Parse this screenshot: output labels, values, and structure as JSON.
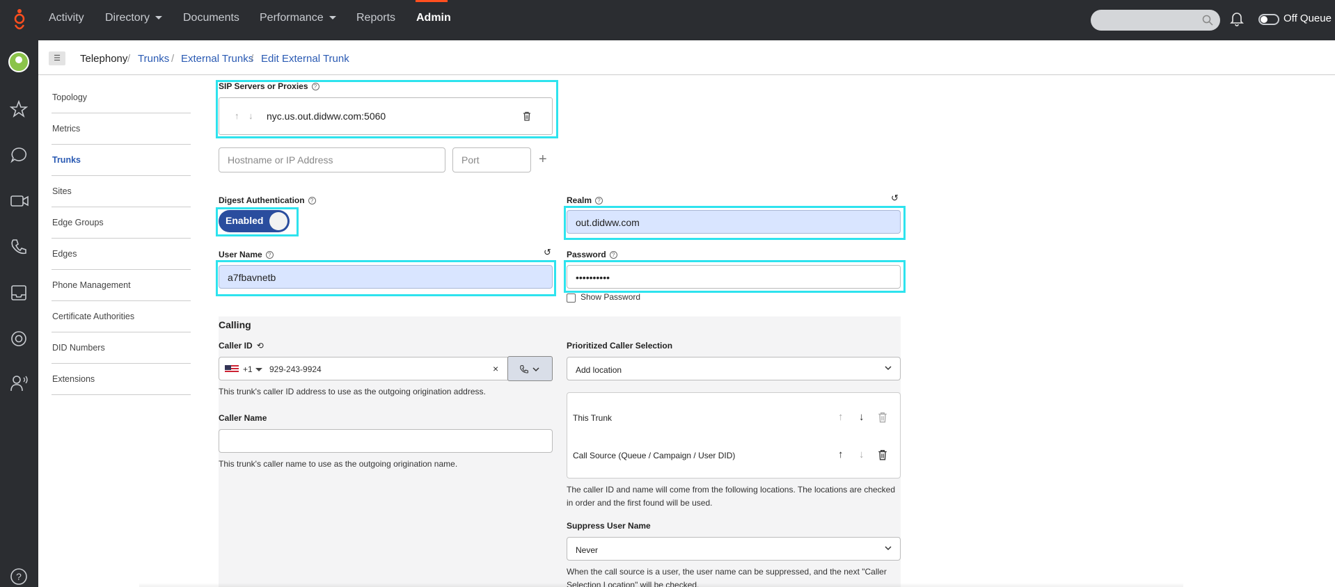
{
  "topnav": {
    "items": [
      {
        "label": "Activity"
      },
      {
        "label": "Directory"
      },
      {
        "label": "Documents"
      },
      {
        "label": "Performance"
      },
      {
        "label": "Reports"
      },
      {
        "label": "Admin"
      }
    ],
    "queue_label": "Off Queue",
    "accent_color": "#ff4f1f"
  },
  "rail": {
    "icons": [
      "avatar",
      "star-icon",
      "chat-icon",
      "video-icon",
      "phone-icon",
      "inbox-icon",
      "lifebuoy-icon",
      "user-voice-icon",
      "help-icon"
    ]
  },
  "breadcrumb": {
    "items": [
      "Telephony",
      "Trunks",
      "External Trunks",
      "Edit External Trunk"
    ],
    "separator": "/"
  },
  "sidenav": {
    "items": [
      {
        "label": "Topology"
      },
      {
        "label": "Metrics"
      },
      {
        "label": "Trunks"
      },
      {
        "label": "Sites"
      },
      {
        "label": "Edge Groups"
      },
      {
        "label": "Edges"
      },
      {
        "label": "Phone Management"
      },
      {
        "label": "Certificate Authorities"
      },
      {
        "label": "DID Numbers"
      },
      {
        "label": "Extensions"
      }
    ],
    "active": "Trunks"
  },
  "sip": {
    "label": "SIP Servers or Proxies",
    "server": "nyc.us.out.didww.com:5060",
    "hostname_placeholder": "Hostname or IP Address",
    "port_placeholder": "Port"
  },
  "digest": {
    "label": "Digest Authentication",
    "toggle_label": "Enabled"
  },
  "realm": {
    "label": "Realm",
    "value": "out.didww.com"
  },
  "username": {
    "label": "User Name",
    "value": "a7fbavnetb"
  },
  "password": {
    "label": "Password",
    "value": "••••••••••",
    "show_label": "Show Password"
  },
  "calling": {
    "title": "Calling",
    "caller_id_label": "Caller ID",
    "country_code": "+1",
    "phone": "929-243-9924",
    "caller_id_help": "This trunk's caller ID address to use as the outgoing origination address.",
    "caller_name_label": "Caller Name",
    "caller_name_value": "",
    "caller_name_help": "This trunk's caller name to use as the outgoing origination name.",
    "prioritized_label": "Prioritized Caller Selection",
    "add_location": "Add location",
    "locations": [
      "This Trunk",
      "Call Source (Queue / Campaign / User DID)"
    ],
    "locations_help_1": "The caller ID and name will come from the following locations. The locations are checked",
    "locations_help_2": "in order and the first found will be used.",
    "suppress_label": "Suppress User Name",
    "suppress_value": "Never",
    "suppress_help_1": "When the call source is a user, the user name can be suppressed, and the next \"Caller",
    "suppress_help_2": "Selection Location\" will be checked."
  }
}
